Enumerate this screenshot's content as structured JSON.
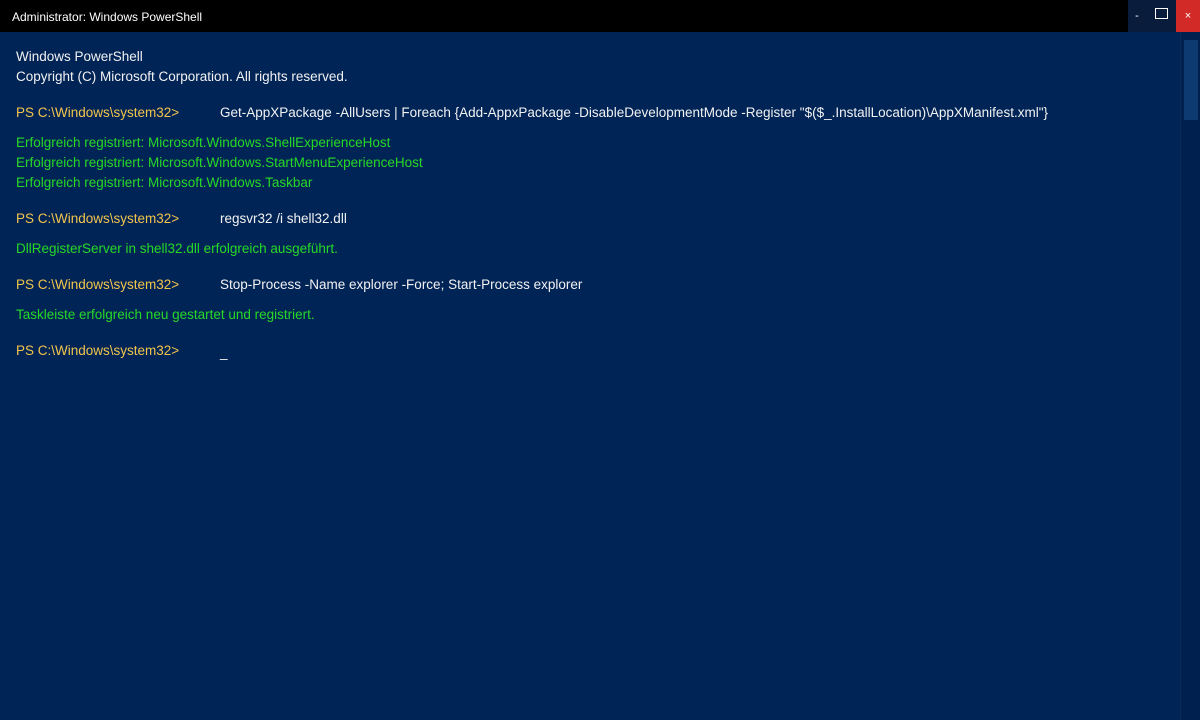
{
  "window": {
    "title": "Administrator: Windows PowerShell",
    "minimize_glyph": "-",
    "maximize_icon": "maximize-icon",
    "close_glyph": "×"
  },
  "console": {
    "header": [
      "Windows PowerShell",
      "Copyright (C) Microsoft Corporation. All rights reserved."
    ],
    "blocks": [
      {
        "prompt": "PS C:\\Windows\\system32>",
        "command": "Get-AppXPackage -AllUsers | Foreach {Add-AppxPackage -DisableDevelopmentMode -Register \"$($_.InstallLocation)\\AppXManifest.xml\"}",
        "output": [
          "Erfolgreich registriert: Microsoft.Windows.ShellExperienceHost",
          "Erfolgreich registriert: Microsoft.Windows.StartMenuExperienceHost",
          "Erfolgreich registriert: Microsoft.Windows.Taskbar"
        ]
      },
      {
        "prompt": "PS C:\\Windows\\system32>",
        "command": "regsvr32 /i shell32.dll",
        "output": [
          "DllRegisterServer in shell32.dll erfolgreich ausgeführt."
        ]
      },
      {
        "prompt": "PS C:\\Windows\\system32>",
        "command": "Stop-Process -Name explorer -Force; Start-Process explorer",
        "output": [
          "Taskleiste erfolgreich neu gestartet und registriert."
        ]
      }
    ],
    "current_prompt": "PS C:\\Windows\\system32>",
    "cursor": "_"
  },
  "colors": {
    "background": "#012456",
    "prompt": "#f2c54c",
    "output_success": "#26d926",
    "text": "#f2f2f2",
    "close_button": "#d22b27"
  }
}
